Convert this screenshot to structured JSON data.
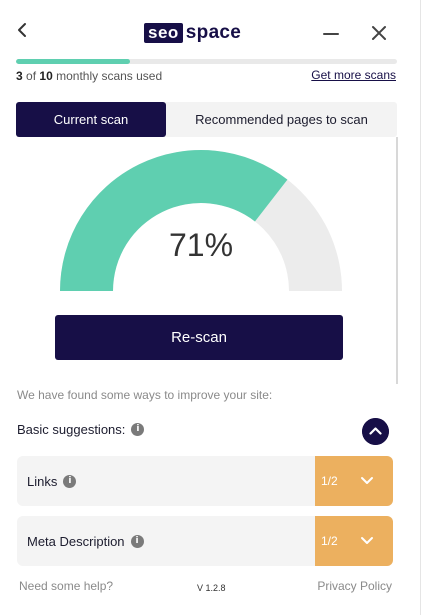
{
  "header": {
    "logo_box": "seo",
    "logo_text": "space"
  },
  "scans": {
    "used": "3",
    "of_label": "of",
    "total": "10",
    "suffix": "monthly scans used",
    "progress_fraction": 0.3,
    "get_more_label": "Get more scans"
  },
  "tabs": [
    {
      "label": "Current scan",
      "active": true
    },
    {
      "label": "Recommended pages to scan",
      "active": false
    }
  ],
  "gauge": {
    "value_label": "71%",
    "fraction": 0.71,
    "fill_color": "#5fcfb0",
    "track_color": "#ececec"
  },
  "rescan_label": "Re-scan",
  "found_text": "We have found some ways to improve your site:",
  "basic": {
    "label": "Basic suggestions:"
  },
  "suggestions": [
    {
      "label": "Links",
      "score": "1/2"
    },
    {
      "label": "Meta Description",
      "score": "1/2"
    }
  ],
  "footer": {
    "help": "Need some help?",
    "version": "V 1.2.8",
    "privacy": "Privacy Policy"
  },
  "colors": {
    "brand": "#170f47",
    "accent": "#5fcfb0",
    "warning": "#ecb05f"
  }
}
